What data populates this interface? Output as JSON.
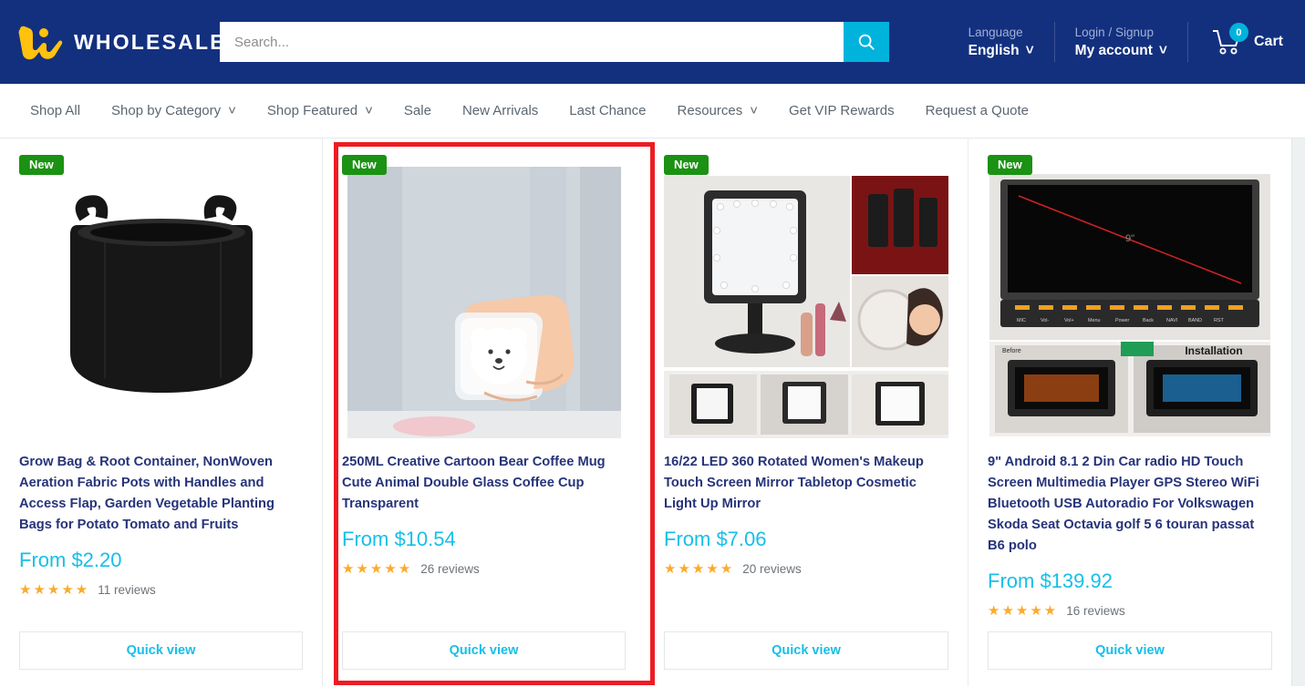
{
  "header": {
    "logo_text": "WHOLESALE",
    "logo_icon": "w-logo-icon",
    "search": {
      "placeholder": "Search...",
      "value": "",
      "button_icon": "search-icon"
    },
    "language": {
      "label": "Language",
      "value": "English",
      "chevron": "˅"
    },
    "account": {
      "label": "Login / Signup",
      "value": "My account",
      "chevron": "˅"
    },
    "cart": {
      "label": "Cart",
      "count": "0",
      "icon": "shopping-cart-icon"
    },
    "colors": {
      "bar": "#13307f",
      "accent": "#00b3dc",
      "muted_text": "#9fb0d6"
    }
  },
  "nav": {
    "items": [
      {
        "label": "Shop All",
        "has_chevron": false
      },
      {
        "label": "Shop by Category",
        "has_chevron": true
      },
      {
        "label": "Shop Featured",
        "has_chevron": true
      },
      {
        "label": "Sale",
        "has_chevron": false
      },
      {
        "label": "New Arrivals",
        "has_chevron": false
      },
      {
        "label": "Last Chance",
        "has_chevron": false
      },
      {
        "label": "Resources",
        "has_chevron": true
      },
      {
        "label": "Get VIP Rewards",
        "has_chevron": false
      },
      {
        "label": "Request a Quote",
        "has_chevron": false
      }
    ],
    "chevron": "˅"
  },
  "products": [
    {
      "badge": "New",
      "title": "Grow Bag & Root Container, NonWoven Aeration Fabric Pots with Handles and Access Flap, Garden Vegetable Planting Bags for Potato Tomato and Fruits",
      "price": "From $2.20",
      "stars": "★★★★★",
      "reviews": "11 reviews",
      "quick_view": "Quick view",
      "image": "black-fabric-grow-bag-photo",
      "highlighted": false
    },
    {
      "badge": "New",
      "title": "250ML Creative Cartoon Bear Coffee Mug Cute Animal Double Glass Coffee Cup Transparent",
      "price": "From $10.54",
      "stars": "★★★★★",
      "reviews": "26 reviews",
      "quick_view": "Quick view",
      "image": "hand-holding-bear-glass-mug-photo",
      "highlighted": true
    },
    {
      "badge": "New",
      "title": "16/22 LED 360 Rotated Women's Makeup Touch Screen Mirror Tabletop Cosmetic Light Up Mirror",
      "price": "From $7.06",
      "stars": "★★★★★",
      "reviews": "20 reviews",
      "quick_view": "Quick view",
      "image": "led-makeup-mirror-collage-photo",
      "highlighted": false
    },
    {
      "badge": "New",
      "title": "9\" Android 8.1 2 Din Car radio HD Touch Screen Multimedia Player GPS Stereo WiFi Bluetooth USB Autoradio For Volkswagen Skoda Seat Octavia golf 5 6 touran passat B6 polo",
      "price": "From $139.92",
      "stars": "★★★★★",
      "reviews": "16 reviews",
      "quick_view": "Quick view",
      "image": "car-radio-head-unit-photo",
      "highlighted": false
    }
  ],
  "highlight": {
    "color": "#ed1c24",
    "target": "product-card-2"
  }
}
